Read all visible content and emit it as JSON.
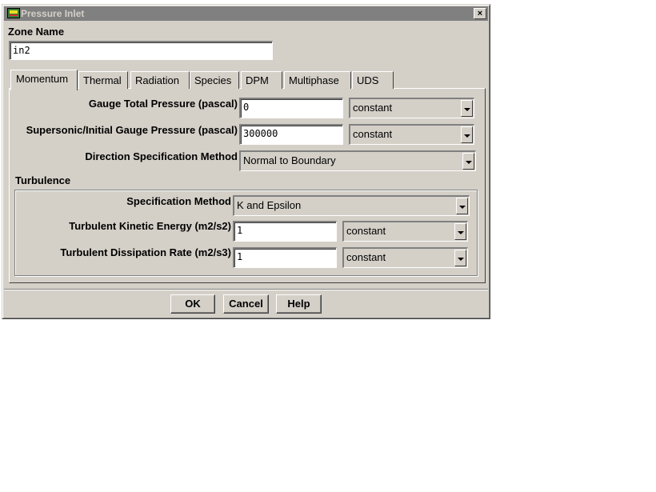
{
  "window": {
    "title": "Pressure Inlet",
    "close_glyph": "×"
  },
  "zone": {
    "label": "Zone Name",
    "value": "in2"
  },
  "tabs": [
    {
      "label": "Momentum",
      "active": true
    },
    {
      "label": "Thermal"
    },
    {
      "label": "Radiation"
    },
    {
      "label": "Species"
    },
    {
      "label": "DPM"
    },
    {
      "label": "Multiphase"
    },
    {
      "label": "UDS"
    }
  ],
  "momentum": {
    "gauge_total_pressure": {
      "label": "Gauge Total Pressure (pascal)",
      "value": "0",
      "profile": "constant"
    },
    "supersonic_pressure": {
      "label": "Supersonic/Initial Gauge Pressure (pascal)",
      "value": "300000",
      "profile": "constant"
    },
    "direction_method": {
      "label": "Direction Specification Method",
      "value": "Normal to Boundary"
    }
  },
  "turbulence": {
    "heading": "Turbulence",
    "spec_method": {
      "label": "Specification Method",
      "value": "K and Epsilon"
    },
    "kinetic_energy": {
      "label": "Turbulent Kinetic Energy (m2/s2)",
      "value": "1",
      "profile": "constant"
    },
    "dissipation_rate": {
      "label": "Turbulent Dissipation Rate (m2/s3)",
      "value": "1",
      "profile": "constant"
    }
  },
  "buttons": {
    "ok": "OK",
    "cancel": "Cancel",
    "help": "Help"
  },
  "icons": {
    "title": "fluent-app-icon",
    "close": "close-icon",
    "dropdown": "dropdown-arrow-icon"
  }
}
